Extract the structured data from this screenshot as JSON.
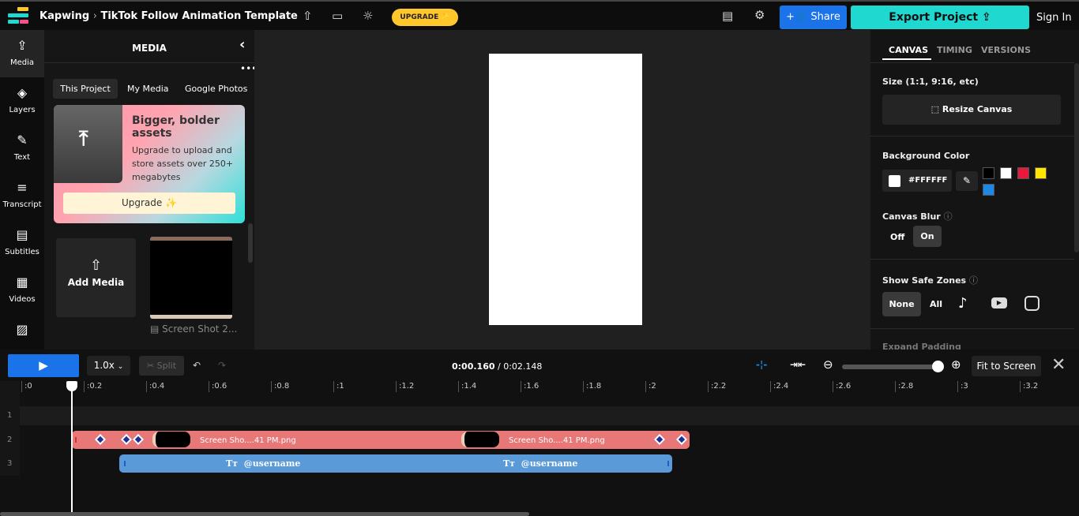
{
  "header": {
    "brand": "Kapwing",
    "separator": "›",
    "project_title": "TikTok Follow Animation Template",
    "upgrade": "UPGRADE ✨",
    "share": "Share",
    "export": "Export Project",
    "sign_in": "Sign In"
  },
  "nav": [
    {
      "label": "Media",
      "icon": "cloud-upload-icon",
      "g": "⇪"
    },
    {
      "label": "Layers",
      "icon": "layers-icon",
      "g": "◈"
    },
    {
      "label": "Text",
      "icon": "text-edit-icon",
      "g": "✎"
    },
    {
      "label": "Transcript",
      "icon": "transcript-icon",
      "g": "≡"
    },
    {
      "label": "Subtitles",
      "icon": "subtitles-icon",
      "g": "▤"
    },
    {
      "label": "Videos",
      "icon": "film-icon",
      "g": "▦"
    },
    {
      "label": "",
      "icon": "image-icon",
      "g": "▨"
    }
  ],
  "media": {
    "title": "MEDIA",
    "tabs": [
      "This Project",
      "My Media",
      "Google Photos"
    ],
    "promo": {
      "title": "Bigger, bolder assets",
      "body": "Upgrade to upload and store assets over 250+ megabytes",
      "button": "Upgrade ✨"
    },
    "add_media": "Add Media",
    "item_name": "Screen Shot 2..."
  },
  "right": {
    "tabs": [
      "CANVAS",
      "TIMING",
      "VERSIONS"
    ],
    "size_label": "Size (1:1, 9:16, etc)",
    "resize": "Resize Canvas",
    "bg_label": "Background Color",
    "bg_value": "#FFFFFF",
    "swatches": [
      "#000000",
      "#FFFFFF",
      "#E8193C",
      "#FFE500",
      "#1E88E5"
    ],
    "blur_label": "Canvas Blur",
    "blur_off": "Off",
    "blur_on": "On",
    "safe_label": "Show Safe Zones",
    "safe_none": "None",
    "safe_all": "All",
    "expand": "Expand Padding"
  },
  "timeline": {
    "speed": "1.0x",
    "split": "Split",
    "current": "0:00.160",
    "total": " / 0:02.148",
    "fit": "Fit to Screen",
    "zoom_level": 1.0,
    "playhead_seconds": 0.16,
    "ticks": [
      ":0",
      ":0.2",
      ":0.4",
      ":0.6",
      ":0.8",
      ":1",
      ":1.2",
      ":1.4",
      ":1.6",
      ":1.8",
      ":2",
      ":2.2",
      ":2.4",
      ":2.6",
      ":2.8",
      ":3",
      ":3.2"
    ],
    "tracks": [
      "1",
      "2",
      "3"
    ],
    "clip_image": "Screen Sho....41 PM.png",
    "clip_text": "@username"
  }
}
